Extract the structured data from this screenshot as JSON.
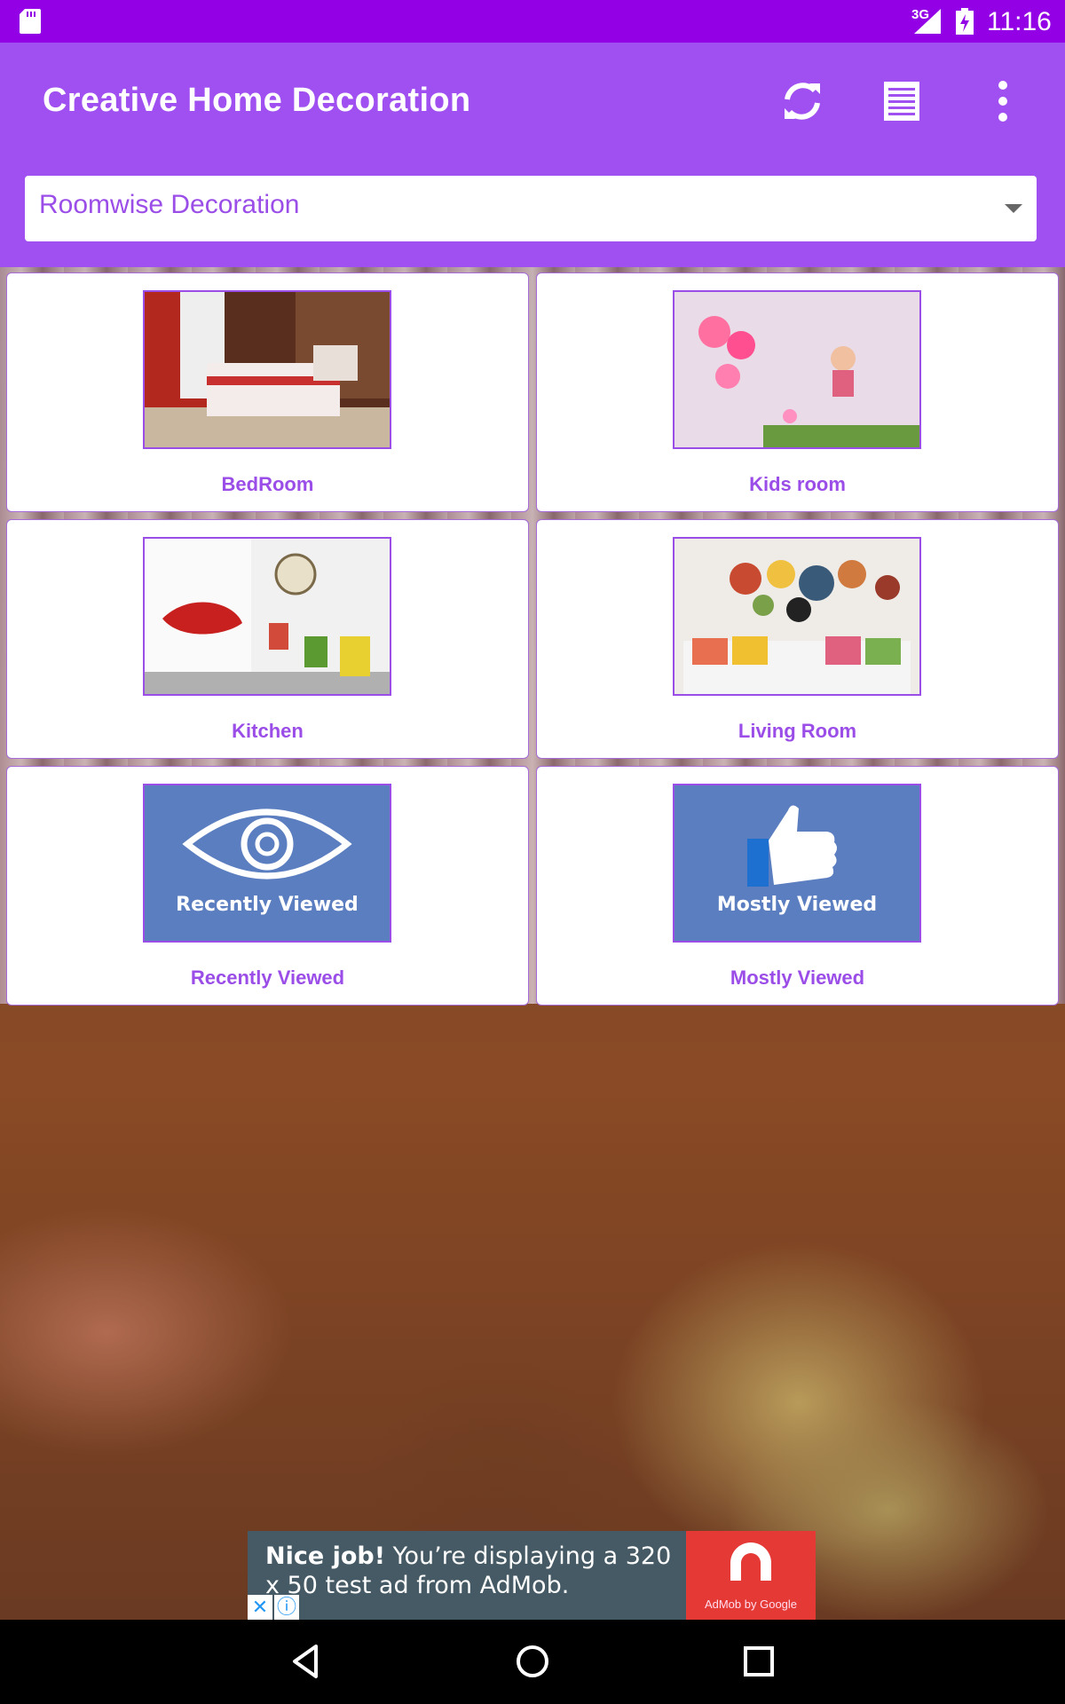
{
  "statusbar": {
    "network": "3G",
    "time": "11:16"
  },
  "app": {
    "title": "Creative Home Decoration"
  },
  "spinner": {
    "selected": "Roomwise Decoration"
  },
  "cards": [
    {
      "label": "BedRoom"
    },
    {
      "label": "Kids room"
    },
    {
      "label": "Kitchen"
    },
    {
      "label": "Living Room"
    },
    {
      "label": "Recently Viewed",
      "image_text": "Recently Viewed"
    },
    {
      "label": "Mostly Viewed",
      "image_text": "Mostly Viewed"
    }
  ],
  "ad": {
    "headline_bold": "Nice job!",
    "headline_rest": " You’re displaying a 320 x 50 test ad from AdMob.",
    "logo_caption": "AdMob by Google"
  },
  "colors": {
    "primary_dark": "#9400e6",
    "primary": "#a050f0",
    "accent": "#9b4de8",
    "ad_bg": "#455a64",
    "ad_logo": "#e53935"
  }
}
